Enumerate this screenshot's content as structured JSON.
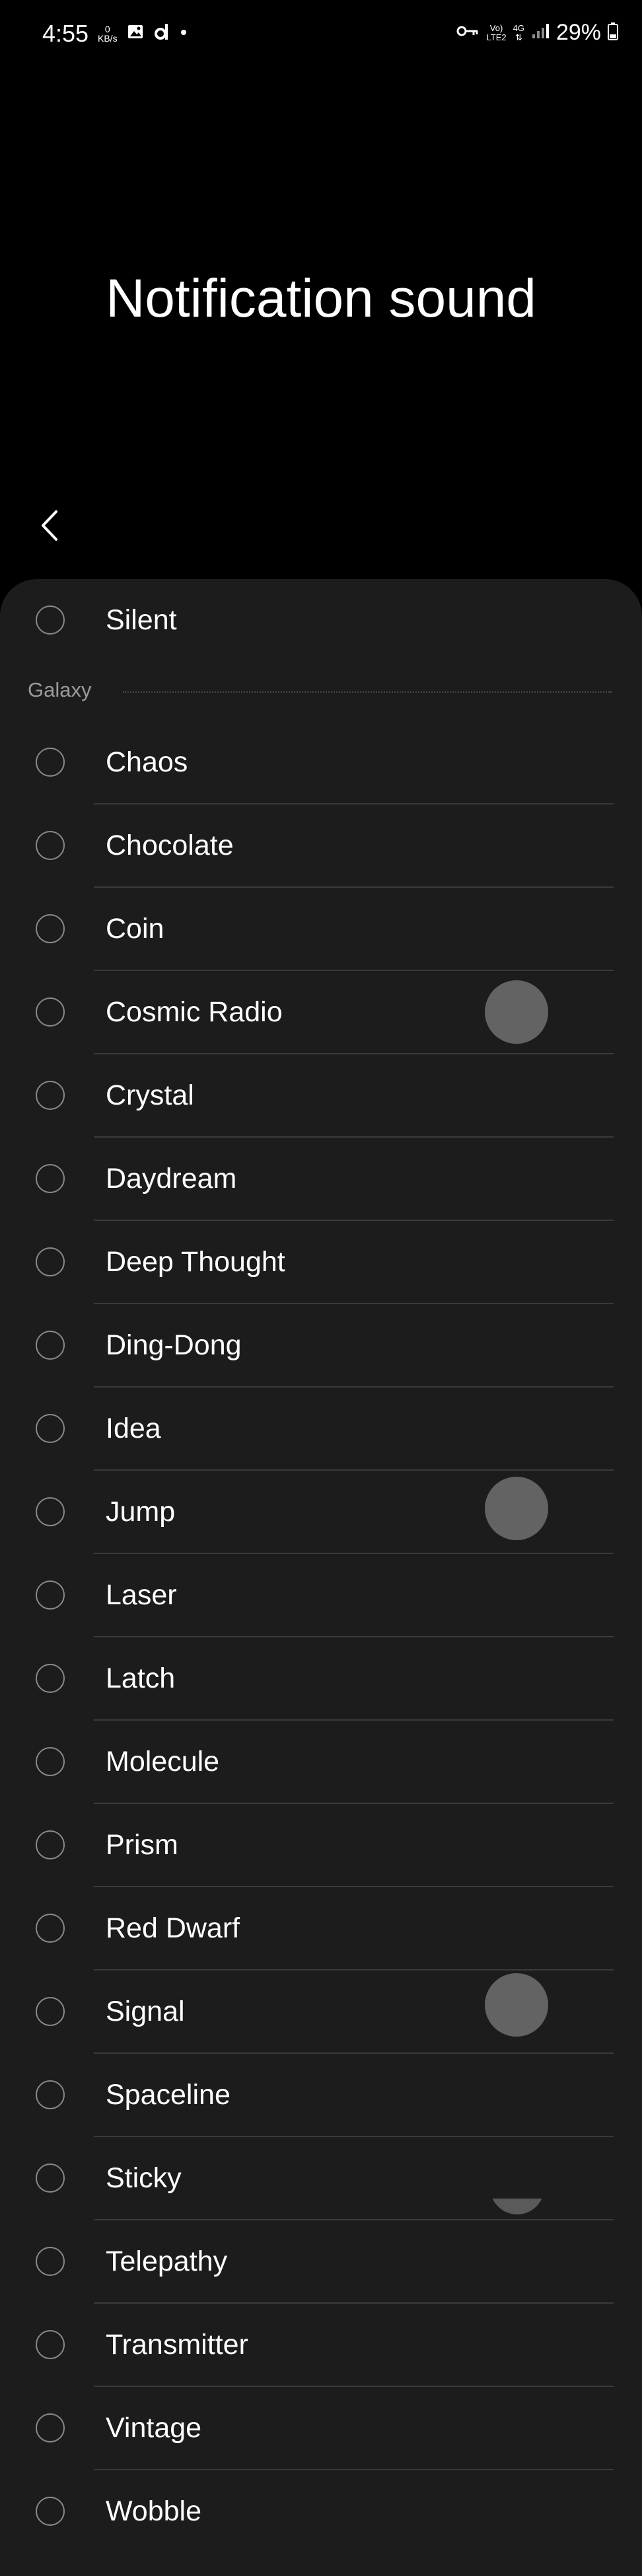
{
  "status_bar": {
    "time": "4:55",
    "net_speed_value": "0",
    "net_speed_unit": "KB/s",
    "network_volte": "Vo)",
    "network_lte": "LTE2",
    "network_4g": "4G",
    "battery": "29%",
    "icons": [
      "image-icon",
      "app-d-icon",
      "dot-icon",
      "vpn-key-icon",
      "signal-icon",
      "battery-icon"
    ]
  },
  "header": {
    "title": "Notification sound",
    "back_icon": "chevron-left-icon"
  },
  "list": {
    "top_item": "Silent",
    "section_title": "Galaxy",
    "items": [
      "Chaos",
      "Chocolate",
      "Coin",
      "Cosmic Radio",
      "Crystal",
      "Daydream",
      "Deep Thought",
      "Ding-Dong",
      "Idea",
      "Jump",
      "Laser",
      "Latch",
      "Molecule",
      "Prism",
      "Red Dwarf",
      "Signal",
      "Spaceline",
      "Sticky",
      "Telepathy",
      "Transmitter",
      "Vintage",
      "Wobble"
    ]
  },
  "colors": {
    "background": "#000000",
    "card": "#1c1c1c",
    "divider": "#3a3a3a",
    "radio_border": "#8a8a8a",
    "section_text": "#9a9a9a"
  }
}
